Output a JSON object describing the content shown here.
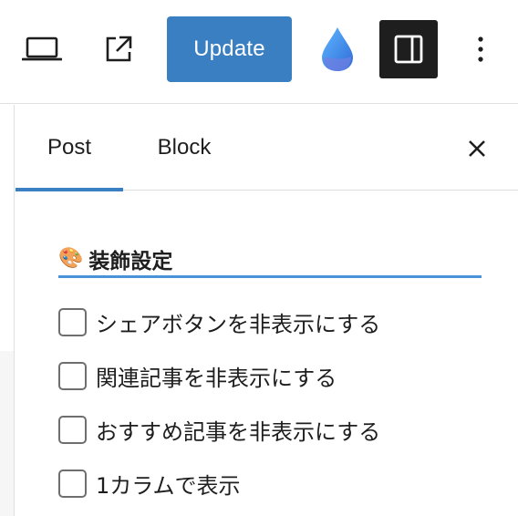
{
  "toolbar": {
    "update_label": "Update",
    "icons": {
      "device_preview": "laptop-icon",
      "view_post": "external-link-icon",
      "plugin": "water-drop-icon",
      "settings": "sidebar-toggle-icon",
      "more": "vertical-ellipsis-icon"
    },
    "colors": {
      "update_bg": "#3a7fc1",
      "settings_bg": "#1e1e1e"
    }
  },
  "sidebar": {
    "tabs": [
      {
        "label": "Post",
        "active": true
      },
      {
        "label": "Block",
        "active": false
      }
    ],
    "close_icon": "close-icon",
    "section": {
      "emoji": "🎨",
      "title": "装飾設定"
    },
    "options": [
      {
        "label": "シェアボタンを非表示にする",
        "checked": false
      },
      {
        "label": "関連記事を非表示にする",
        "checked": false
      },
      {
        "label": "おすすめ記事を非表示にする",
        "checked": false
      },
      {
        "label": "1カラムで表示",
        "checked": false
      }
    ],
    "colors": {
      "accent": "#3a7fc1",
      "underline": "#4a93d8"
    }
  }
}
